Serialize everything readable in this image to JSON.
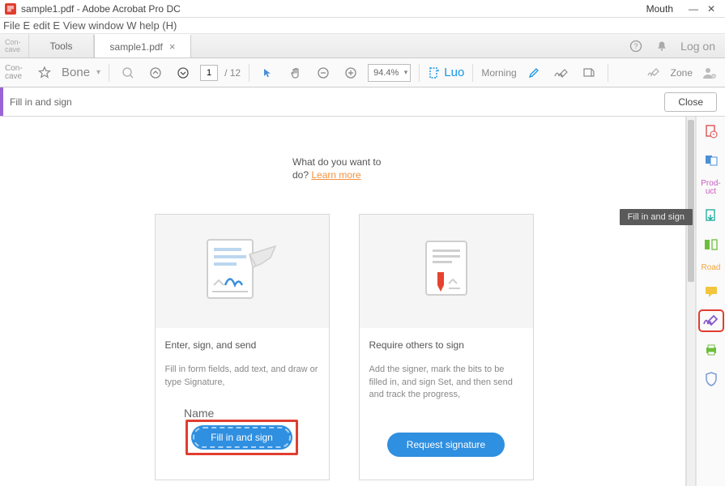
{
  "window": {
    "title": "sample1.pdf - Adobe Acrobat Pro DC",
    "right_label": "Mouth"
  },
  "menubar": {
    "text": "File E edit E View window W help (H)"
  },
  "tabs": {
    "left_small": "Con-\ncave",
    "tools": "Tools",
    "document": "sample1.pdf",
    "log_on": "Log on"
  },
  "toolbar": {
    "bone": "Bone",
    "page_current": "1",
    "page_total": "/ 12",
    "zoom": "94.4%",
    "luo": "Luo",
    "morning": "Morning",
    "zone": "Zone"
  },
  "fsbar": {
    "label": "Fill in and sign",
    "close": "Close"
  },
  "content": {
    "prompt_text": "What do you want to do? ",
    "prompt_link": "Learn more",
    "cards": [
      {
        "title": "Enter, sign, and send",
        "desc": "Fill in form fields, add text, and draw or type Signature,",
        "cta": "Fill in and sign"
      },
      {
        "title": "Require others to sign",
        "desc": "Add the signer, mark the bits to be filled in, and sign Set, and then send and track the progress,",
        "cta": "Request signature"
      }
    ]
  },
  "tooltip": "Fill in and sign",
  "rightrail": {
    "product": "Prod-\nuct",
    "road": "Road",
    "name": "Name"
  }
}
